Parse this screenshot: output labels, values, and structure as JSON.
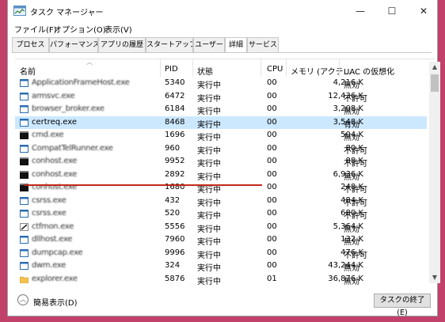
{
  "window": {
    "title": "タスク マネージャー",
    "controls": {
      "minimize": "—",
      "maximize": "☐",
      "close": "✕"
    }
  },
  "menu": [
    "ファイル(F)",
    "オプション(O)",
    "表示(V)"
  ],
  "tabs": [
    "プロセス",
    "パフォーマンス",
    "アプリの履歴",
    "スタートアップ",
    "ユーザー",
    "詳細",
    "サービス"
  ],
  "active_tab": "詳細",
  "columns": [
    "名前",
    "PID",
    "状態",
    "CPU",
    "メモリ (アクテ...",
    "UAC の仮想化"
  ],
  "rows": [
    {
      "name": "ApplicationFrameHost.exe",
      "pid": "5340",
      "status": "実行中",
      "cpu": "00",
      "memory": "4,216 K",
      "uac": "無効",
      "blurred": true,
      "icon": "window-icon"
    },
    {
      "name": "armsvc.exe",
      "pid": "6472",
      "status": "実行中",
      "cpu": "00",
      "memory": "12,436 K",
      "uac": "不許可",
      "blurred": true,
      "icon": "window-icon"
    },
    {
      "name": "browser_broker.exe",
      "pid": "6184",
      "status": "実行中",
      "cpu": "00",
      "memory": "3,208 K",
      "uac": "無効",
      "blurred": true,
      "icon": "window-icon"
    },
    {
      "name": "certreq.exe",
      "pid": "8468",
      "status": "実行中",
      "cpu": "00",
      "memory": "3,548 K",
      "uac": "有効",
      "blurred": false,
      "icon": "window-icon",
      "selected": true
    },
    {
      "name": "cmd.exe",
      "pid": "1696",
      "status": "実行中",
      "cpu": "00",
      "memory": "504 K",
      "uac": "無効",
      "blurred": true,
      "icon": "console-icon"
    },
    {
      "name": "CompatTelRunner.exe",
      "pid": "960",
      "status": "実行中",
      "cpu": "00",
      "memory": "80 K",
      "uac": "不許可",
      "blurred": true,
      "icon": "window-icon"
    },
    {
      "name": "conhost.exe",
      "pid": "9952",
      "status": "実行中",
      "cpu": "00",
      "memory": "88 K",
      "uac": "不許可",
      "blurred": true,
      "icon": "console-icon"
    },
    {
      "name": "conhost.exe",
      "pid": "2892",
      "status": "実行中",
      "cpu": "00",
      "memory": "6,936 K",
      "uac": "無効",
      "blurred": true,
      "icon": "console-icon"
    },
    {
      "name": "conhost.exe",
      "pid": "1680",
      "status": "実行中",
      "cpu": "00",
      "memory": "248 K",
      "uac": "不許可",
      "blurred": true,
      "icon": "console-icon"
    },
    {
      "name": "csrss.exe",
      "pid": "432",
      "status": "実行中",
      "cpu": "00",
      "memory": "484 K",
      "uac": "不許可",
      "blurred": true,
      "icon": "window-icon"
    },
    {
      "name": "csrss.exe",
      "pid": "520",
      "status": "実行中",
      "cpu": "00",
      "memory": "680 K",
      "uac": "不許可",
      "blurred": true,
      "icon": "window-icon"
    },
    {
      "name": "ctfmon.exe",
      "pid": "5556",
      "status": "実行中",
      "cpu": "00",
      "memory": "5,364 K",
      "uac": "無効",
      "blurred": true,
      "icon": "pen-icon"
    },
    {
      "name": "dllhost.exe",
      "pid": "7960",
      "status": "実行中",
      "cpu": "00",
      "memory": "132 K",
      "uac": "無効",
      "blurred": true,
      "icon": "window-icon"
    },
    {
      "name": "dumpcap.exe",
      "pid": "9996",
      "status": "実行中",
      "cpu": "00",
      "memory": "476 K",
      "uac": "不許可",
      "blurred": true,
      "icon": "window-icon"
    },
    {
      "name": "dwm.exe",
      "pid": "324",
      "status": "実行中",
      "cpu": "00",
      "memory": "43,244 K",
      "uac": "無効",
      "blurred": true,
      "icon": "window-icon"
    },
    {
      "name": "explorer.exe",
      "pid": "5876",
      "status": "実行中",
      "cpu": "01",
      "memory": "36,876 K",
      "uac": "無効",
      "blurred": true,
      "icon": "folder-icon"
    }
  ],
  "footer": {
    "fewer_details": "簡易表示(D)",
    "end_task": "タスクの終了(E)"
  }
}
